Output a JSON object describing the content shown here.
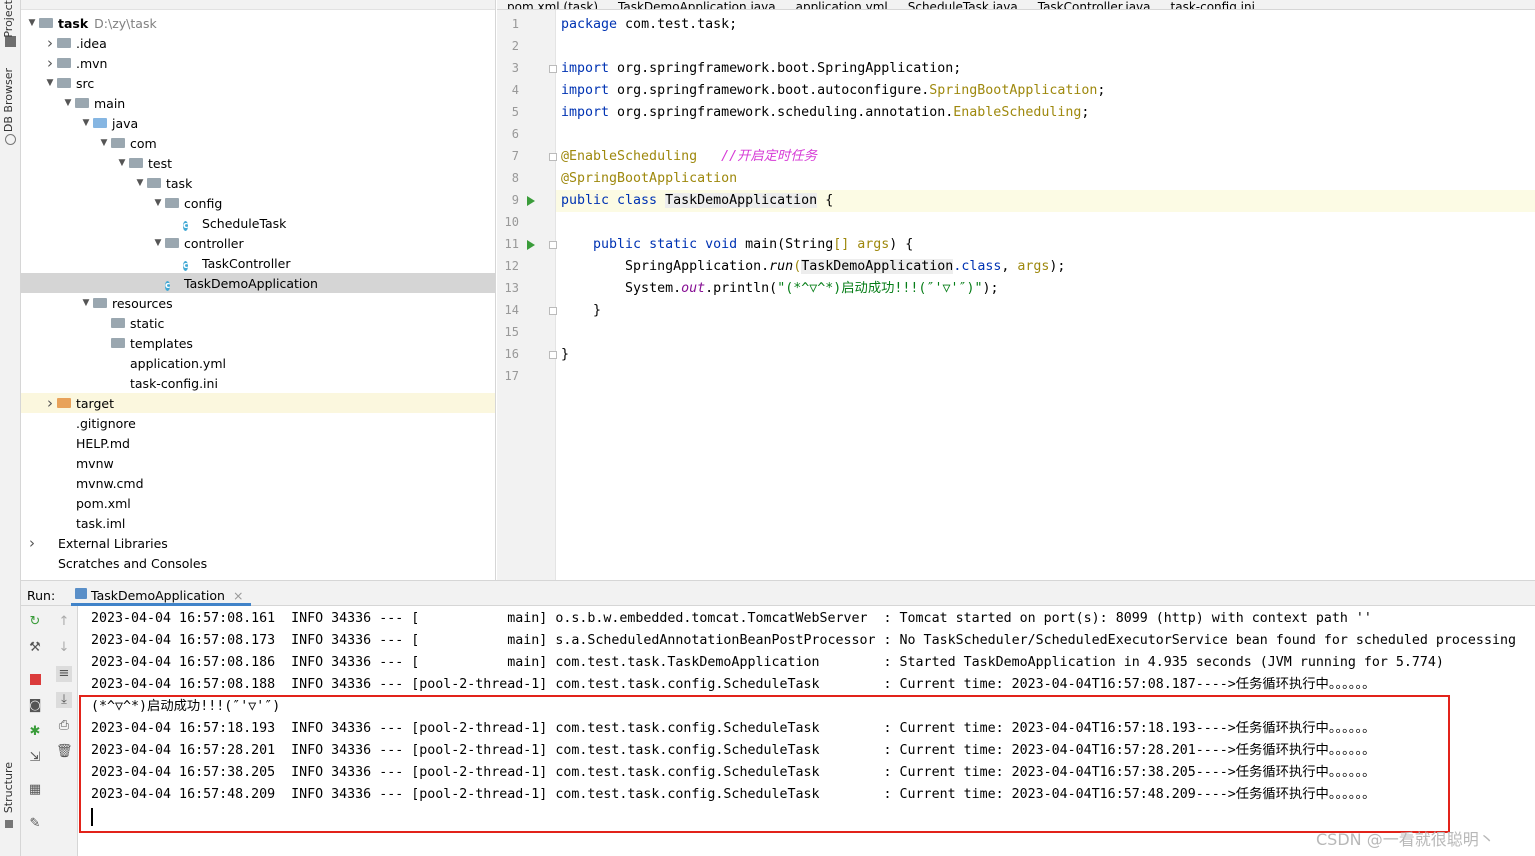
{
  "left_strip": {
    "project": "Project",
    "db_browser": "DB Browser",
    "structure": "Structure"
  },
  "tree": {
    "root": {
      "name": "task",
      "path": "D:\\zy\\task"
    },
    "items": [
      {
        "label": ".idea",
        "type": "folder",
        "indent": 1,
        "arrow": "right"
      },
      {
        "label": ".mvn",
        "type": "folder",
        "indent": 1,
        "arrow": "right"
      },
      {
        "label": "src",
        "type": "folder",
        "indent": 1,
        "arrow": "down"
      },
      {
        "label": "main",
        "type": "folder",
        "indent": 2,
        "arrow": "down"
      },
      {
        "label": "java",
        "type": "folder-blue",
        "indent": 3,
        "arrow": "down"
      },
      {
        "label": "com",
        "type": "folder",
        "indent": 4,
        "arrow": "down"
      },
      {
        "label": "test",
        "type": "folder",
        "indent": 5,
        "arrow": "down"
      },
      {
        "label": "task",
        "type": "folder",
        "indent": 6,
        "arrow": "down"
      },
      {
        "label": "config",
        "type": "folder",
        "indent": 7,
        "arrow": "down"
      },
      {
        "label": "ScheduleTask",
        "type": "class",
        "indent": 8,
        "arrow": ""
      },
      {
        "label": "controller",
        "type": "folder",
        "indent": 7,
        "arrow": "down"
      },
      {
        "label": "TaskController",
        "type": "class",
        "indent": 8,
        "arrow": ""
      },
      {
        "label": "TaskDemoApplication",
        "type": "class",
        "indent": 7,
        "arrow": "",
        "selected": true
      },
      {
        "label": "resources",
        "type": "folder",
        "indent": 3,
        "arrow": "down"
      },
      {
        "label": "static",
        "type": "folder",
        "indent": 4,
        "arrow": ""
      },
      {
        "label": "templates",
        "type": "folder",
        "indent": 4,
        "arrow": ""
      },
      {
        "label": "application.yml",
        "type": "file",
        "indent": 4,
        "arrow": ""
      },
      {
        "label": "task-config.ini",
        "type": "file",
        "indent": 4,
        "arrow": ""
      },
      {
        "label": "target",
        "type": "folder-orange",
        "indent": 1,
        "arrow": "right",
        "highlight": true
      },
      {
        "label": ".gitignore",
        "type": "file",
        "indent": 1,
        "arrow": ""
      },
      {
        "label": "HELP.md",
        "type": "file",
        "indent": 1,
        "arrow": ""
      },
      {
        "label": "mvnw",
        "type": "file",
        "indent": 1,
        "arrow": ""
      },
      {
        "label": "mvnw.cmd",
        "type": "file",
        "indent": 1,
        "arrow": ""
      },
      {
        "label": "pom.xml",
        "type": "file",
        "indent": 1,
        "arrow": ""
      },
      {
        "label": "task.iml",
        "type": "file",
        "indent": 1,
        "arrow": ""
      },
      {
        "label": "External Libraries",
        "type": "lib",
        "indent": 0,
        "arrow": "right"
      },
      {
        "label": "Scratches and Consoles",
        "type": "scratch",
        "indent": 0,
        "arrow": ""
      }
    ]
  },
  "editor_tabs": [
    {
      "label": "pom.xml (task)",
      "active": false
    },
    {
      "label": "TaskDemoApplication.java",
      "active": true
    },
    {
      "label": "application.yml",
      "active": false
    },
    {
      "label": "ScheduleTask.java",
      "active": false
    },
    {
      "label": "TaskController.java",
      "active": false
    },
    {
      "label": "task-config.ini",
      "active": false
    }
  ],
  "code": {
    "line_numbers": [
      "1",
      "2",
      "3",
      "4",
      "5",
      "6",
      "7",
      "8",
      "9",
      "10",
      "11",
      "12",
      "13",
      "14",
      "15",
      "16",
      "17"
    ],
    "l1": {
      "kw": "package",
      "rest": " com.test.task;"
    },
    "l3": {
      "kw": "import",
      "rest": " org.springframework.boot.SpringApplication;"
    },
    "l4": {
      "kw": "import",
      "rest": " org.springframework.boot.autoconfigure.",
      "cls": "SpringBootApplication",
      "end": ";"
    },
    "l5": {
      "kw": "import",
      "rest": " org.springframework.scheduling.annotation.",
      "cls": "EnableScheduling",
      "end": ";"
    },
    "l7": {
      "ann": "@EnableScheduling",
      "pad": "   ",
      "cmt": "//",
      "cmtcn": "开启定时任务"
    },
    "l8": {
      "ann": "@SpringBootApplication"
    },
    "l9": {
      "kw": "public class ",
      "name": "TaskDemoApplication",
      "end": " {"
    },
    "l11": {
      "indent": "    ",
      "kw": "public static void ",
      "name": "main(String",
      "br": "[]",
      "param": " args",
      "end": ") {"
    },
    "l12": {
      "indent": "        ",
      "a": "SpringApplication.",
      "run": "run",
      "b": "(",
      "cls": "TaskDemoApplication",
      ".class": ".class",
      "c": ", ",
      "args": "args",
      "end": ");"
    },
    "l13": {
      "indent": "        ",
      "a": "System.",
      "out": "out",
      ".println": ".println(",
      "str": "\"(*^▽^*)启动成功!!!(″'▽'″)\"",
      "end": ");"
    },
    "l14": {
      "text": "    }"
    },
    "l16": {
      "text": "}"
    }
  },
  "run": {
    "label": "Run:",
    "tab": "TaskDemoApplication",
    "logs": [
      "2023-04-04 16:57:08.161  INFO 34336 --- [           main] o.s.b.w.embedded.tomcat.TomcatWebServer  : Tomcat started on port(s): 8099 (http) with context path ''",
      "2023-04-04 16:57:08.173  INFO 34336 --- [           main] s.a.ScheduledAnnotationBeanPostProcessor : No TaskScheduler/ScheduledExecutorService bean found for scheduled processing",
      "2023-04-04 16:57:08.186  INFO 34336 --- [           main] com.test.task.TaskDemoApplication        : Started TaskDemoApplication in 4.935 seconds (JVM running for 5.774)",
      "2023-04-04 16:57:08.188  INFO 34336 --- [pool-2-thread-1] com.test.task.config.ScheduleTask        : Current time: 2023-04-04T16:57:08.187---->任务循环执行中。。。。。。",
      "(*^▽^*)启动成功!!!(″'▽'″)",
      "2023-04-04 16:57:18.193  INFO 34336 --- [pool-2-thread-1] com.test.task.config.ScheduleTask        : Current time: 2023-04-04T16:57:18.193---->任务循环执行中。。。。。。",
      "2023-04-04 16:57:28.201  INFO 34336 --- [pool-2-thread-1] com.test.task.config.ScheduleTask        : Current time: 2023-04-04T16:57:28.201---->任务循环执行中。。。。。。",
      "2023-04-04 16:57:38.205  INFO 34336 --- [pool-2-thread-1] com.test.task.config.ScheduleTask        : Current time: 2023-04-04T16:57:38.205---->任务循环执行中。。。。。。",
      "2023-04-04 16:57:48.209  INFO 34336 --- [pool-2-thread-1] com.test.task.config.ScheduleTask        : Current time: 2023-04-04T16:57:48.209---->任务循环执行中。。。。。。"
    ]
  },
  "watermark": "CSDN @一看就很聪明丶",
  "colors": {
    "keyword": "#0033b3",
    "annotation": "#9e880d",
    "string": "#067d17",
    "highlight_box": "#e2231a",
    "accent": "#4083c9"
  }
}
